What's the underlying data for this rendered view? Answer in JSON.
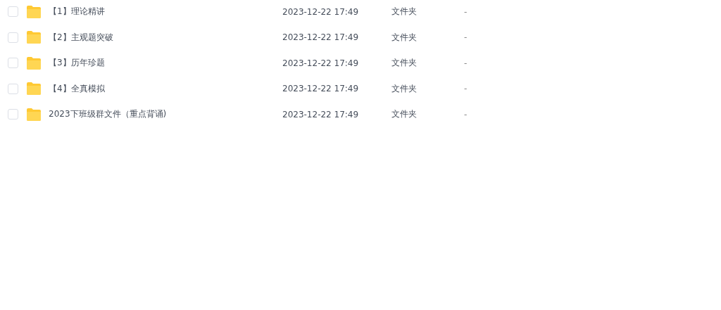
{
  "files": [
    {
      "checked": false,
      "name": "【1】理论精讲",
      "modified": "2023-12-22 17:49",
      "type": "文件夹",
      "size": "-"
    },
    {
      "checked": false,
      "name": "【2】主观题突破",
      "modified": "2023-12-22 17:49",
      "type": "文件夹",
      "size": "-"
    },
    {
      "checked": false,
      "name": "【3】历年珍题",
      "modified": "2023-12-22 17:49",
      "type": "文件夹",
      "size": "-"
    },
    {
      "checked": false,
      "name": "【4】全真模拟",
      "modified": "2023-12-22 17:49",
      "type": "文件夹",
      "size": "-"
    },
    {
      "checked": false,
      "name": "2023下班级群文件（重点背诵)",
      "modified": "2023-12-22 17:49",
      "type": "文件夹",
      "size": "-"
    }
  ]
}
